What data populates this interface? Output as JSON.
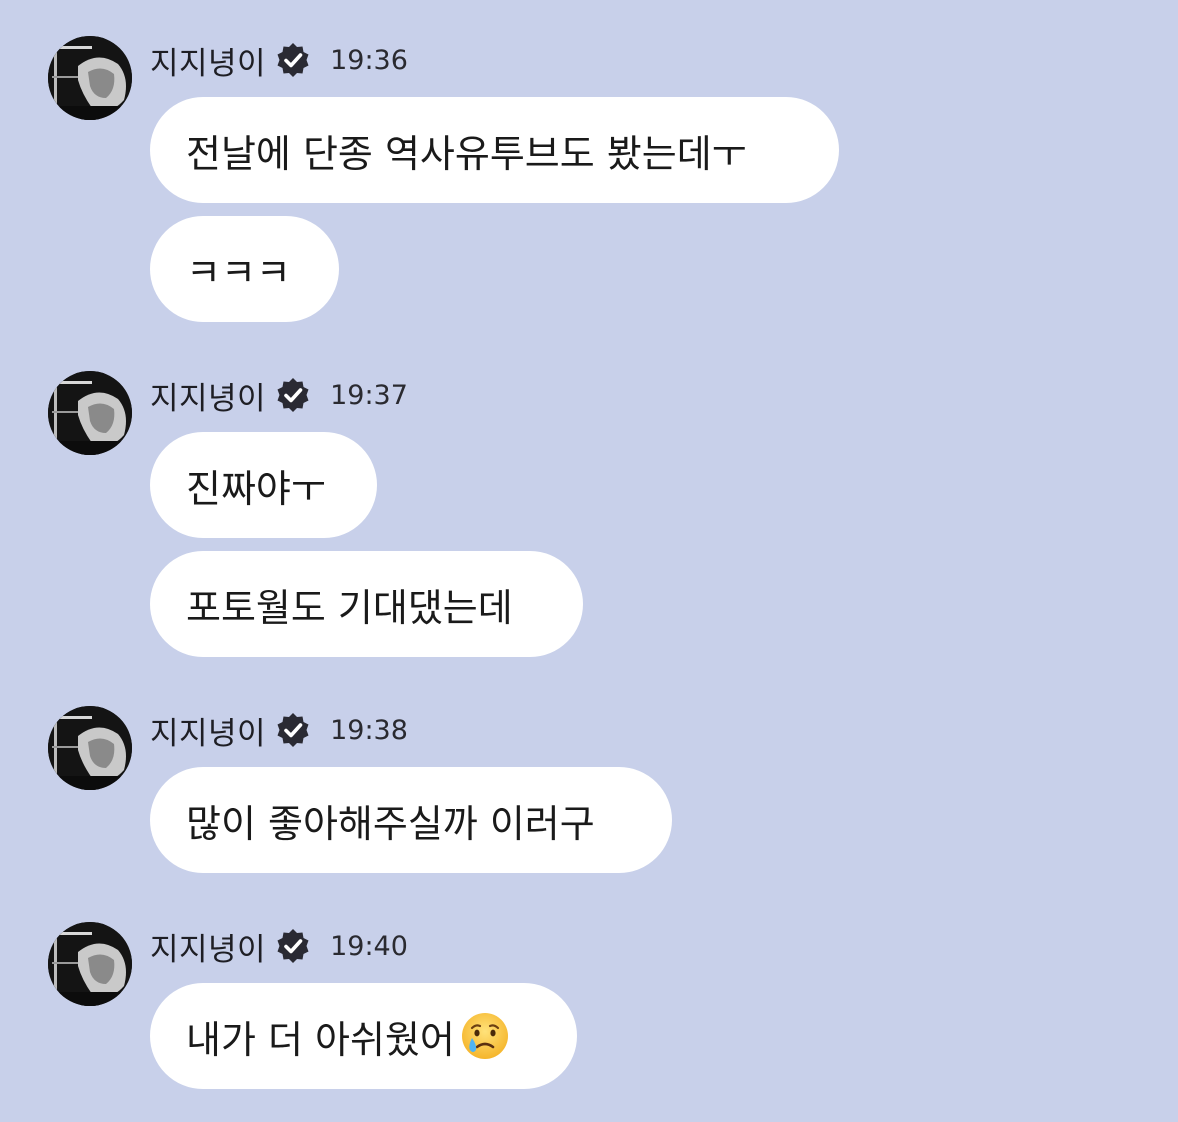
{
  "chat": {
    "background": "#c8d0ea",
    "bubble_color": "#ffffff",
    "groups": [
      {
        "sender": "지지녕이",
        "verified_icon": "verified-badge-icon",
        "time": "19:36",
        "messages": [
          "전날에 단종 역사유투브도 봤는데ㅜ",
          "ㅋㅋㅋ"
        ]
      },
      {
        "sender": "지지녕이",
        "verified_icon": "verified-badge-icon",
        "time": "19:37",
        "messages": [
          "진짜야ㅜ",
          "포토월도 기대댔는데"
        ]
      },
      {
        "sender": "지지녕이",
        "verified_icon": "verified-badge-icon",
        "time": "19:38",
        "messages": [
          "많이 좋아해주실까 이러구"
        ]
      },
      {
        "sender": "지지녕이",
        "verified_icon": "verified-badge-icon",
        "time": "19:40",
        "messages": [
          "내가 더 아쉬웠어"
        ],
        "trailing_emoji": "crying-face-icon"
      }
    ]
  }
}
